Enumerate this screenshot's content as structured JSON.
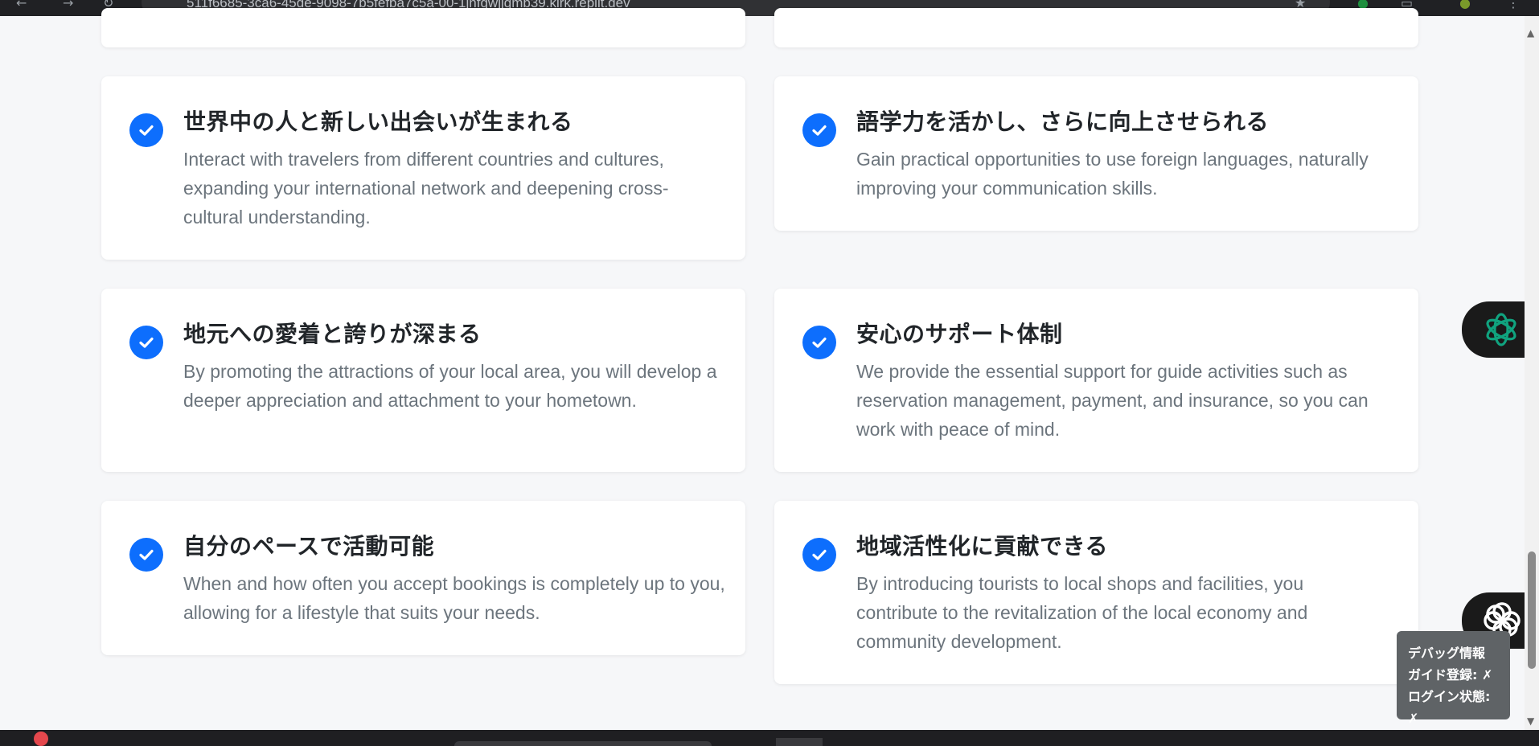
{
  "browser": {
    "url": "511f6685-3ca6-45de-9098-7b5fefba7c5a-00-1jnfgwjjgmb39.kirk.replit.dev"
  },
  "cards": [
    {
      "title": "世界中の人と新しい出会いが生まれる",
      "desc": "Interact with travelers from different countries and cultures, expanding your international network and deepening cross-cultural understanding."
    },
    {
      "title": "語学力を活かし、さらに向上させられる",
      "desc": "Gain practical opportunities to use foreign languages, naturally improving your communication skills."
    },
    {
      "title": "地元への愛着と誇りが深まる",
      "desc": "By promoting the attractions of your local area, you will develop a deeper appreciation and attachment to your hometown."
    },
    {
      "title": "安心のサポート体制",
      "desc": "We provide the essential support for guide activities such as reservation management, payment, and insurance, so you can work with peace of mind."
    },
    {
      "title": "自分のペースで活動可能",
      "desc": "When and how often you accept bookings is completely up to you, allowing for a lifestyle that suits your needs."
    },
    {
      "title": "地域活性化に貢献できる",
      "desc": "By introducing tourists to local shops and facilities, you contribute to the revitalization of the local economy and community development."
    }
  ],
  "debug": {
    "heading": "デバッグ情報",
    "guide_line": "ガイド登録: ✗",
    "login_line": "ログイン状態: ✗"
  },
  "icons": {
    "check": "check-circle-icon",
    "assistant_top": "openai-logo-icon",
    "assistant_bottom": "flower-logo-icon"
  },
  "colors": {
    "accent": "#0d6efd",
    "background": "#f6f7f9",
    "card": "#ffffff",
    "desc_text": "#6c757d"
  }
}
